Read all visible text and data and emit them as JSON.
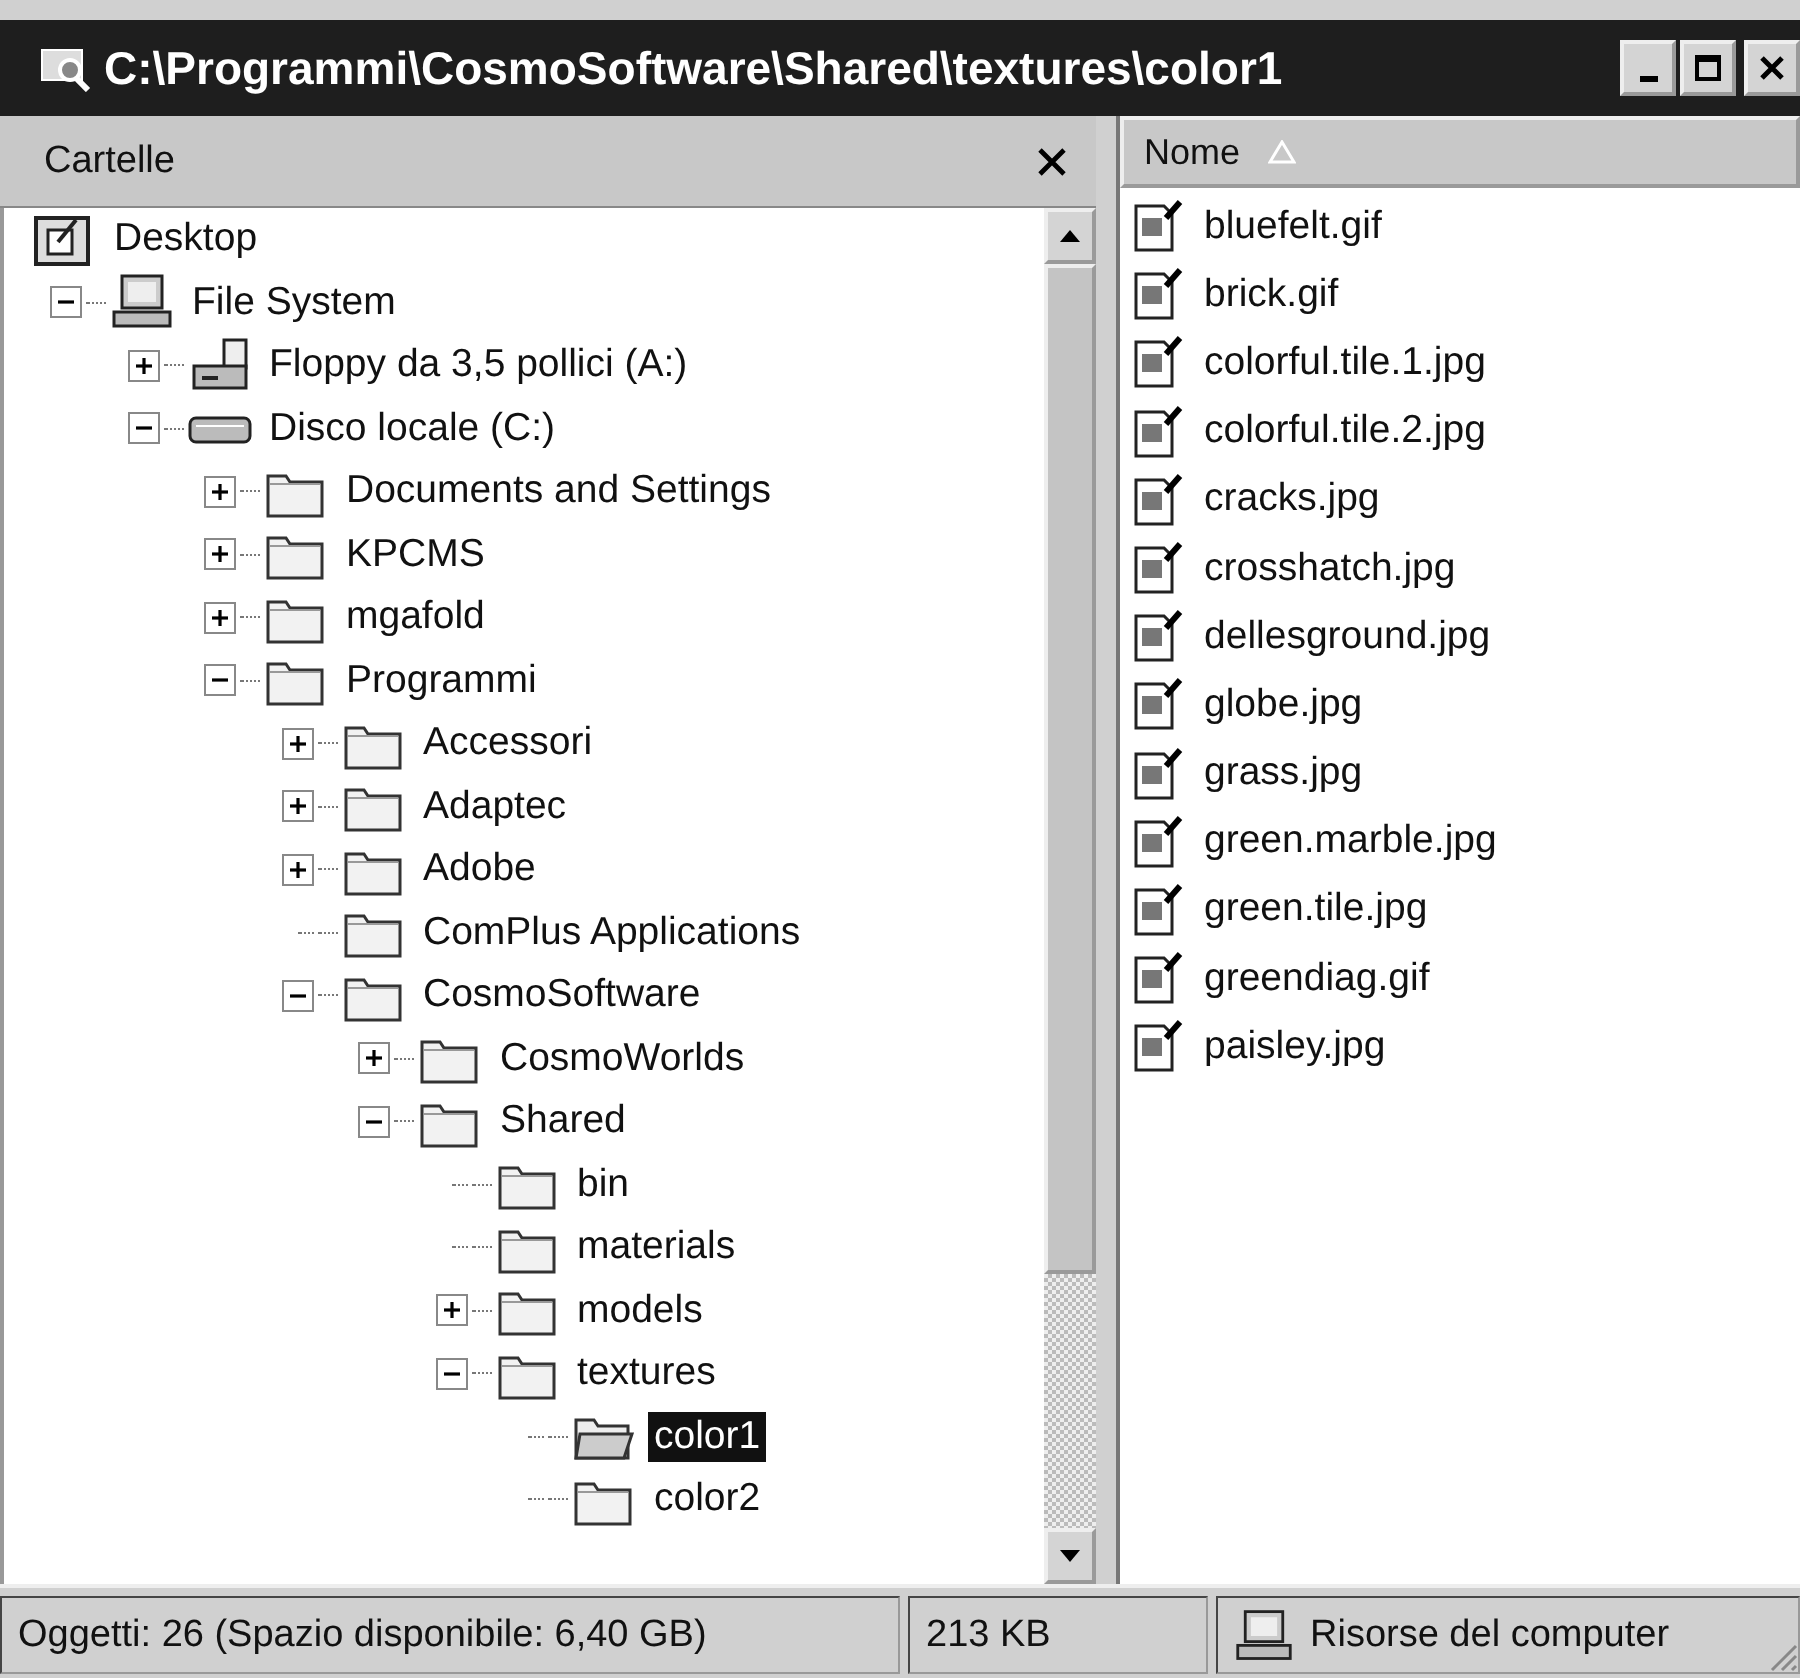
{
  "window": {
    "title": "C:\\Programmi\\CosmoSoftware\\Shared\\textures\\color1"
  },
  "folder_pane": {
    "title": "Cartelle",
    "tree": [
      {
        "label": "Desktop",
        "kind": "desktop",
        "selected": false,
        "children": [
          {
            "label": "File System",
            "kind": "computer",
            "expanded": true,
            "selected": false,
            "children": [
              {
                "label": "Floppy da 3,5 pollici (A:)",
                "kind": "floppy",
                "expanded": false,
                "selected": false
              },
              {
                "label": "Disco locale (C:)",
                "kind": "drive",
                "expanded": true,
                "selected": false,
                "children": [
                  {
                    "label": "Documents and Settings",
                    "kind": "folder",
                    "expanded": false,
                    "selected": false
                  },
                  {
                    "label": "KPCMS",
                    "kind": "folder",
                    "expanded": false,
                    "selected": false
                  },
                  {
                    "label": "mgafold",
                    "kind": "folder",
                    "expanded": false,
                    "selected": false
                  },
                  {
                    "label": "Programmi",
                    "kind": "folder",
                    "expanded": true,
                    "selected": false,
                    "children": [
                      {
                        "label": "Accessori",
                        "kind": "folder",
                        "expanded": false,
                        "selected": false
                      },
                      {
                        "label": "Adaptec",
                        "kind": "folder",
                        "expanded": false,
                        "selected": false
                      },
                      {
                        "label": "Adobe",
                        "kind": "folder",
                        "expanded": false,
                        "selected": false
                      },
                      {
                        "label": "ComPlus Applications",
                        "kind": "folder",
                        "selected": false
                      },
                      {
                        "label": "CosmoSoftware",
                        "kind": "folder",
                        "expanded": true,
                        "selected": false,
                        "children": [
                          {
                            "label": "CosmoWorlds",
                            "kind": "folder",
                            "expanded": false,
                            "selected": false
                          },
                          {
                            "label": "Shared",
                            "kind": "folder",
                            "expanded": true,
                            "selected": false,
                            "children": [
                              {
                                "label": "bin",
                                "kind": "folder",
                                "selected": false
                              },
                              {
                                "label": "materials",
                                "kind": "folder",
                                "selected": false
                              },
                              {
                                "label": "models",
                                "kind": "folder",
                                "expanded": false,
                                "selected": false
                              },
                              {
                                "label": "textures",
                                "kind": "folder",
                                "expanded": true,
                                "selected": false,
                                "children": [
                                  {
                                    "label": "color1",
                                    "kind": "folder",
                                    "selected": true
                                  },
                                  {
                                    "label": "color2",
                                    "kind": "folder",
                                    "selected": false
                                  }
                                ]
                              }
                            ]
                          }
                        ]
                      }
                    ]
                  }
                ]
              }
            ]
          }
        ]
      }
    ]
  },
  "file_list": {
    "column": "Nome",
    "files": [
      {
        "name": "bluefelt.gif",
        "selected": false
      },
      {
        "name": "brick.gif",
        "selected": false
      },
      {
        "name": "colorful.tile.1.jpg",
        "selected": false
      },
      {
        "name": "colorful.tile.2.jpg",
        "selected": false
      },
      {
        "name": "cracks.jpg",
        "selected": false
      },
      {
        "name": "crosshatch.jpg",
        "selected": false
      },
      {
        "name": "dellesground.jpg",
        "selected": false
      },
      {
        "name": "globe.jpg",
        "selected": false
      },
      {
        "name": "grass.jpg",
        "selected": false
      },
      {
        "name": "green.marble.jpg",
        "selected": false
      },
      {
        "name": "green.tile.jpg",
        "selected": false
      },
      {
        "name": "greendiag.gif",
        "selected": false
      },
      {
        "name": "paisley.jpg",
        "selected": false
      }
    ]
  },
  "status_bar": {
    "objects": "Oggetti: 26 (Spazio disponibile: 6,40 GB)",
    "size": "213 KB",
    "location": "Risorse del computer"
  }
}
